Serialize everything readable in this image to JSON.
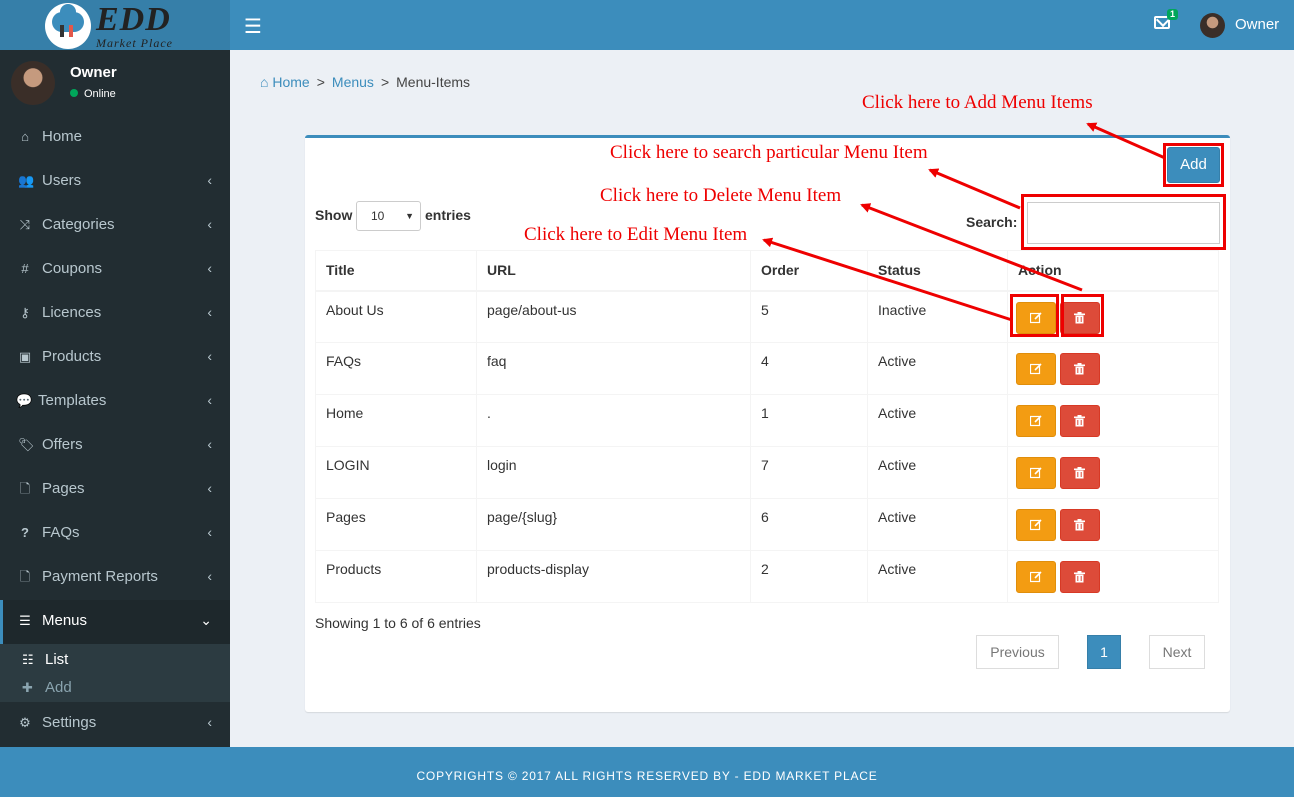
{
  "brand": {
    "logo_text": "EDD",
    "logo_sub": "Market Place"
  },
  "header": {
    "mail_badge": "1",
    "user": "Owner"
  },
  "user_panel": {
    "name": "Owner",
    "status": "Online"
  },
  "sidebar": {
    "items": [
      {
        "label": "Home",
        "icon": "home-icon"
      },
      {
        "label": "Users",
        "icon": "users-icon"
      },
      {
        "label": "Categories",
        "icon": "shuffle-icon"
      },
      {
        "label": "Coupons",
        "icon": "hash-icon"
      },
      {
        "label": "Licences",
        "icon": "key-icon"
      },
      {
        "label": "Products",
        "icon": "bag-icon"
      },
      {
        "label": "Templates",
        "icon": "comment-icon"
      },
      {
        "label": "Offers",
        "icon": "tags-icon"
      },
      {
        "label": "Pages",
        "icon": "file-icon"
      },
      {
        "label": "FAQs",
        "icon": "question-icon"
      },
      {
        "label": "Payment Reports",
        "icon": "file-icon"
      },
      {
        "label": "Menus",
        "icon": "bars-icon"
      },
      {
        "label": "Settings",
        "icon": "gear-icon"
      }
    ],
    "submenu": [
      {
        "label": "List"
      },
      {
        "label": "Add"
      }
    ]
  },
  "breadcrumb": {
    "home": "Home",
    "menus": "Menus",
    "current": "Menu-Items"
  },
  "toolbar": {
    "add_label": "Add"
  },
  "table_controls": {
    "show": "Show",
    "page_size": "10",
    "entries": "entries",
    "search_label": "Search:"
  },
  "table": {
    "headers": {
      "title": "Title",
      "url": "URL",
      "order": "Order",
      "status": "Status",
      "action": "Action"
    },
    "rows": [
      {
        "title": "About Us",
        "url": "page/about-us",
        "order": "5",
        "status": "Inactive"
      },
      {
        "title": "FAQs",
        "url": "faq",
        "order": "4",
        "status": "Active"
      },
      {
        "title": "Home",
        "url": ".",
        "order": "1",
        "status": "Active"
      },
      {
        "title": "LOGIN",
        "url": "login",
        "order": "7",
        "status": "Active"
      },
      {
        "title": "Pages",
        "url": "page/{slug}",
        "order": "6",
        "status": "Active"
      },
      {
        "title": "Products",
        "url": "products-display",
        "order": "2",
        "status": "Active"
      }
    ]
  },
  "pagination": {
    "info": "Showing 1 to 6 of 6 entries",
    "previous": "Previous",
    "current": "1",
    "next": "Next"
  },
  "annotations": {
    "add": "Click here to Add Menu Items",
    "search": "Click here to search particular Menu Item",
    "delete": "Click here to Delete Menu Item",
    "edit": "Click here to Edit Menu Item"
  },
  "footer": {
    "text": "COPYRIGHTS © 2017 ALL RIGHTS RESERVED BY - EDD MARKET PLACE"
  },
  "colors": {
    "primary": "#3c8dbc",
    "sidebar": "#222d32",
    "warning": "#f39c12",
    "danger": "#dd4b39",
    "annotation": "#ee0000"
  }
}
